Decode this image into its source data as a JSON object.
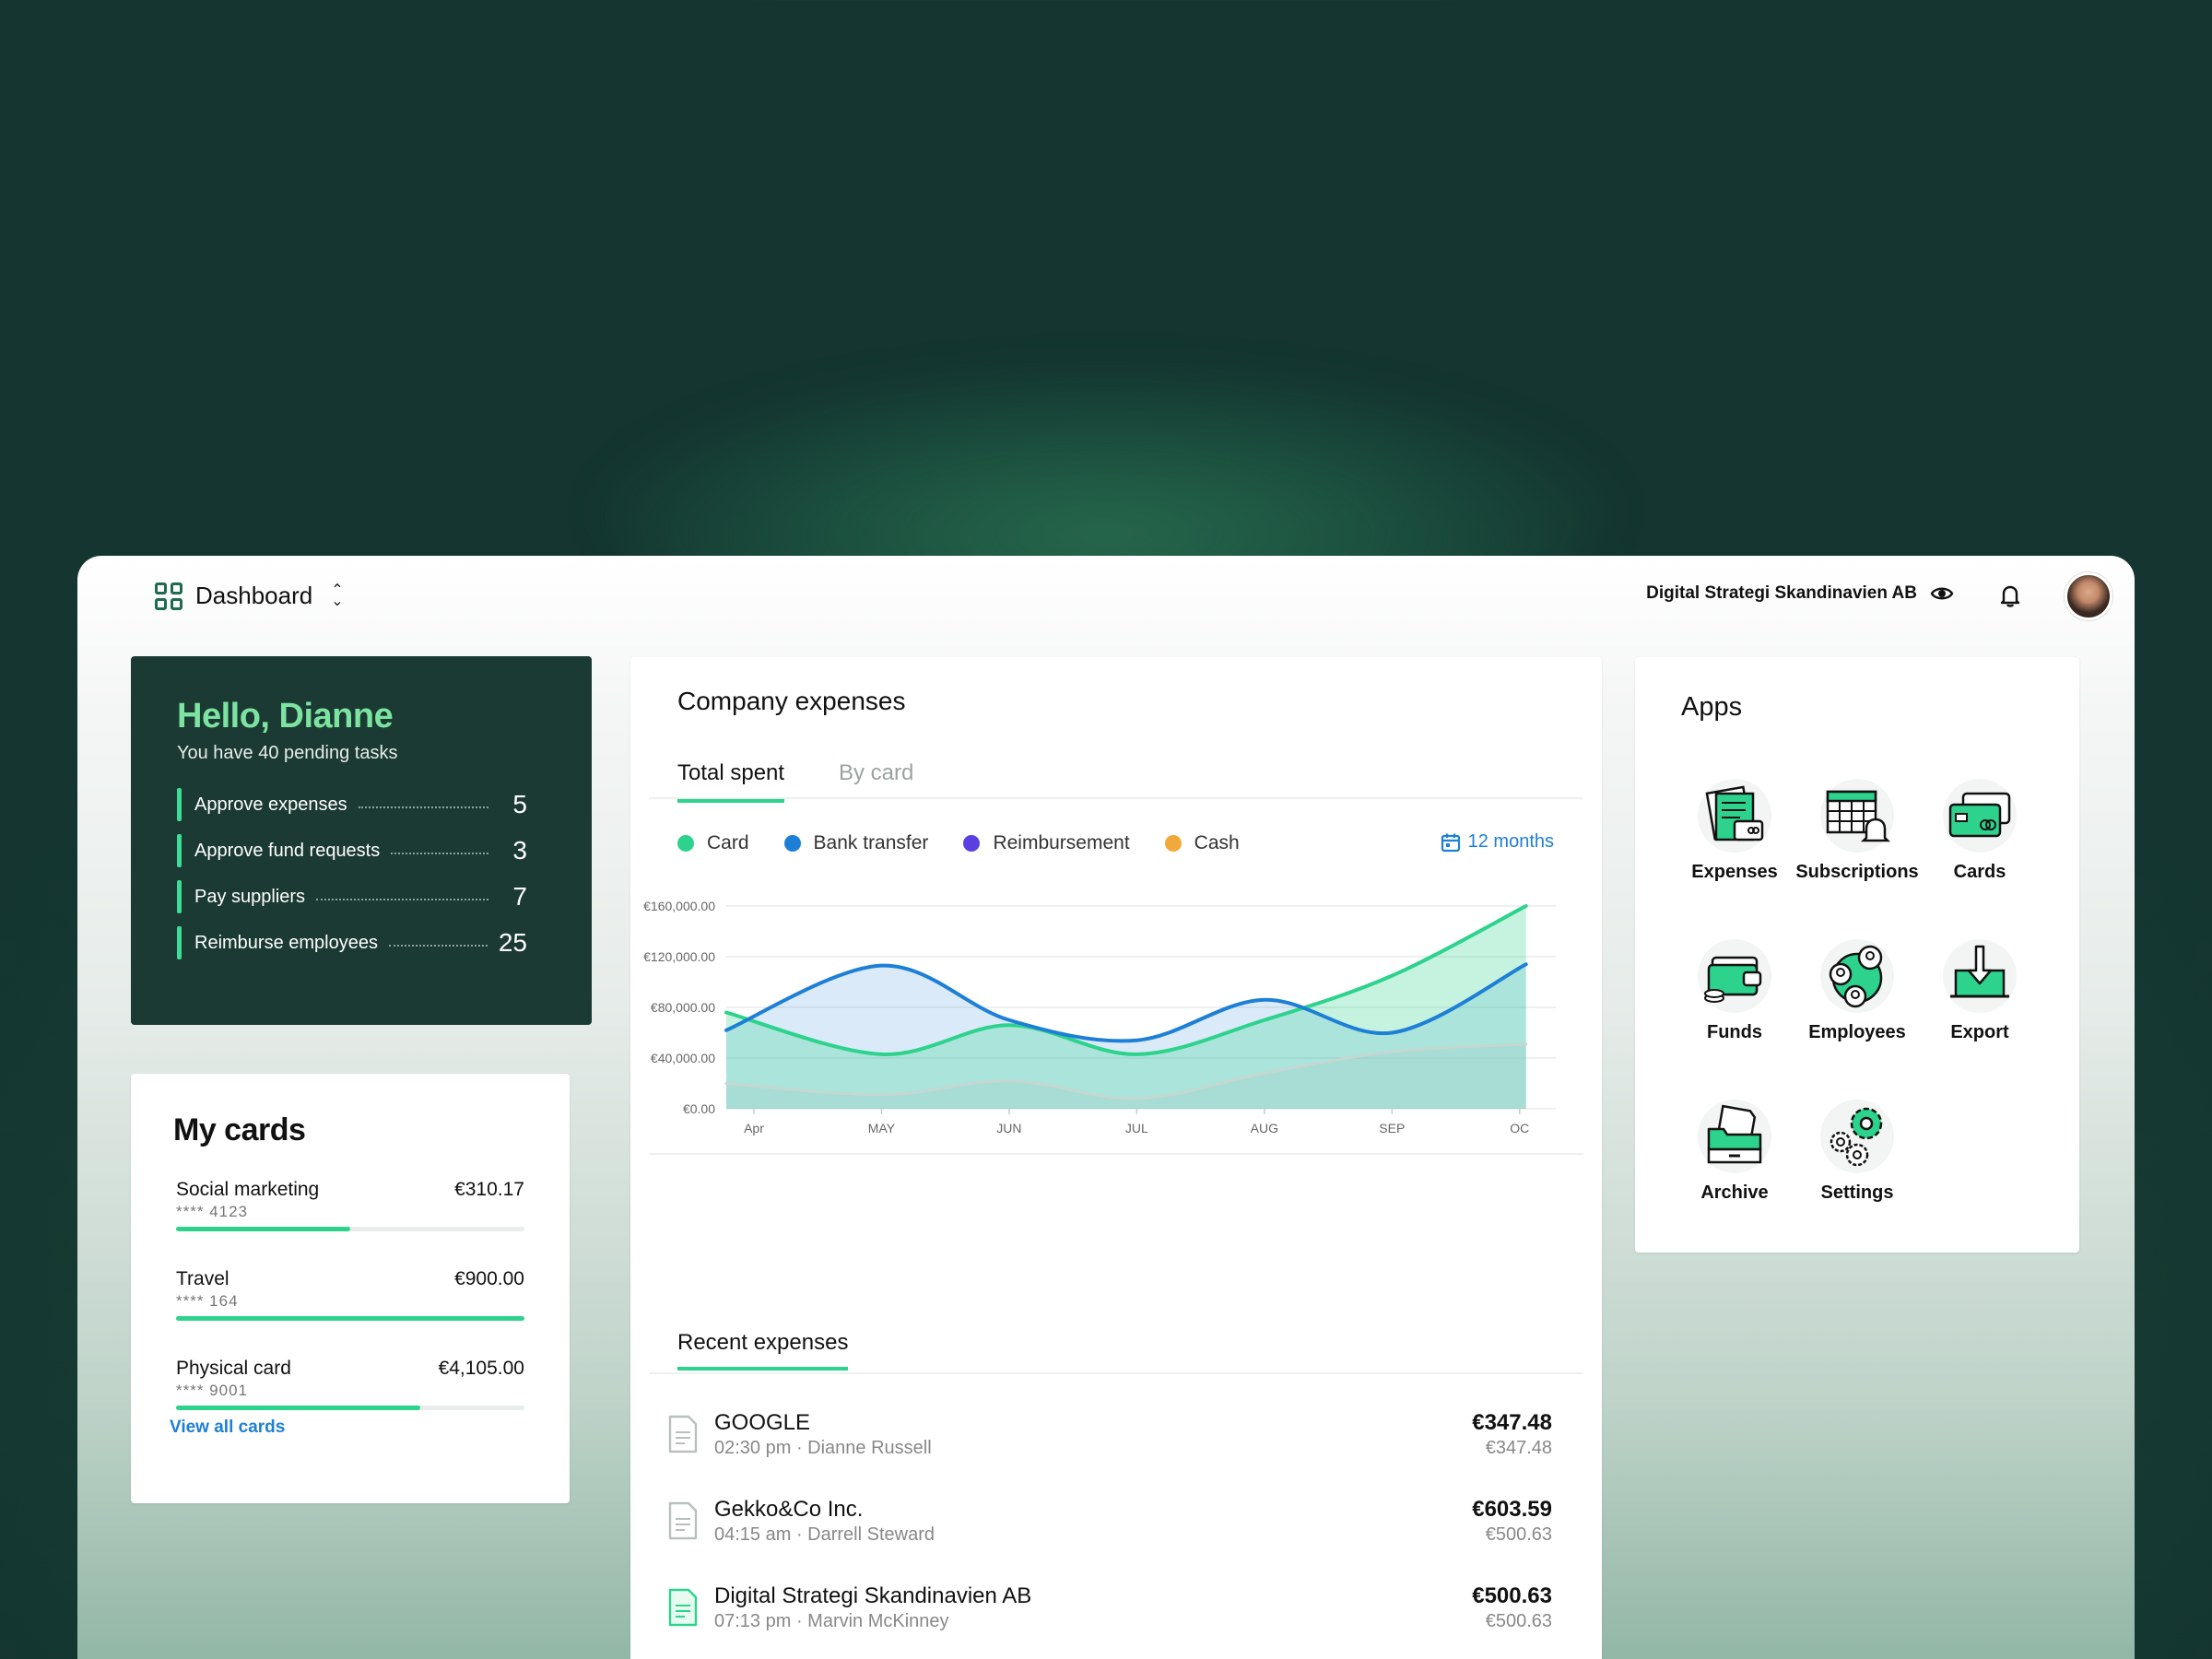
{
  "header": {
    "title": "Dashboard",
    "company": "Digital Strategi Skandinavien AB"
  },
  "greeting": {
    "title": "Hello, Dianne",
    "subtitle": "You have 40 pending tasks",
    "tasks": [
      {
        "label": "Approve expenses",
        "count": "5"
      },
      {
        "label": "Approve fund requests",
        "count": "3"
      },
      {
        "label": "Pay suppliers",
        "count": "7"
      },
      {
        "label": "Reimburse employees",
        "count": "25"
      }
    ]
  },
  "my_cards": {
    "title": "My cards",
    "cards": [
      {
        "name": "Social marketing",
        "number": "**** 4123",
        "amount": "€310.17",
        "usage": 0.5
      },
      {
        "name": "Travel",
        "number": "**** 164",
        "amount": "€900.00",
        "usage": 1.0
      },
      {
        "name": "Physical card",
        "number": "**** 9001",
        "amount": "€4,105.00",
        "usage": 0.7
      }
    ],
    "view_all": "View all cards"
  },
  "company_expenses": {
    "title": "Company expenses",
    "tabs": [
      {
        "label": "Total spent",
        "active": true
      },
      {
        "label": "By card",
        "active": false
      }
    ],
    "legend": [
      {
        "label": "Card",
        "color": "#2dd38c"
      },
      {
        "label": "Bank transfer",
        "color": "#1e7fd6"
      },
      {
        "label": "Reimbursement",
        "color": "#5b3fe0"
      },
      {
        "label": "Cash",
        "color": "#f2a93b"
      }
    ],
    "range": "12 months"
  },
  "chart_data": {
    "type": "area",
    "x": [
      "Apr",
      "MAY",
      "JUN",
      "JUL",
      "AUG",
      "SEP",
      "OC"
    ],
    "y_ticks": [
      "€160,000.00",
      "€120,000.00",
      "€80,000.00",
      "€40,000.00",
      "€0.00"
    ],
    "ylim": [
      0,
      160000
    ],
    "series": [
      {
        "name": "Card",
        "color": "#2dd38c",
        "points": [
          [
            0,
            76000
          ],
          [
            1,
            43000
          ],
          [
            2,
            66000
          ],
          [
            3,
            43000
          ],
          [
            4,
            70000
          ],
          [
            5,
            105000
          ],
          [
            6.05,
            160000
          ]
        ]
      },
      {
        "name": "Bank transfer",
        "color": "#1e7fd6",
        "points": [
          [
            0,
            62000
          ],
          [
            1,
            113000
          ],
          [
            2,
            70000
          ],
          [
            3,
            54000
          ],
          [
            4,
            86000
          ],
          [
            5,
            60000
          ],
          [
            6.05,
            114000
          ]
        ]
      },
      {
        "name": "Reimbursement",
        "color": "#b5c9c1",
        "points": [
          [
            0,
            20000
          ],
          [
            1,
            11000
          ],
          [
            2,
            22000
          ],
          [
            3,
            8000
          ],
          [
            4,
            28000
          ],
          [
            5,
            45000
          ],
          [
            6.05,
            51000
          ]
        ]
      }
    ]
  },
  "recent_expenses": {
    "title": "Recent expenses",
    "items": [
      {
        "merchant": "GOOGLE",
        "meta": "02:30 pm · Dianne Russell",
        "amount": "€347.48",
        "converted": "€347.48",
        "doc_color": "#b9bfbd"
      },
      {
        "merchant": "Gekko&Co Inc.",
        "meta": "04:15 am · Darrell Steward",
        "amount": "€603.59",
        "converted": "€500.63",
        "doc_color": "#b9bfbd"
      },
      {
        "merchant": "Digital Strategi Skandinavien AB",
        "meta": "07:13 pm · Marvin McKinney",
        "amount": "€500.63",
        "converted": "€500.63",
        "doc_color": "#2dd38c"
      }
    ]
  },
  "apps": {
    "title": "Apps",
    "items": [
      {
        "label": "Expenses",
        "icon": "expenses-icon"
      },
      {
        "label": "Subscriptions",
        "icon": "subscriptions-icon"
      },
      {
        "label": "Cards",
        "icon": "cards-icon"
      },
      {
        "label": "Funds",
        "icon": "funds-icon"
      },
      {
        "label": "Employees",
        "icon": "employees-icon"
      },
      {
        "label": "Export",
        "icon": "export-icon"
      },
      {
        "label": "Archive",
        "icon": "archive-icon"
      },
      {
        "label": "Settings",
        "icon": "settings-icon"
      }
    ]
  }
}
